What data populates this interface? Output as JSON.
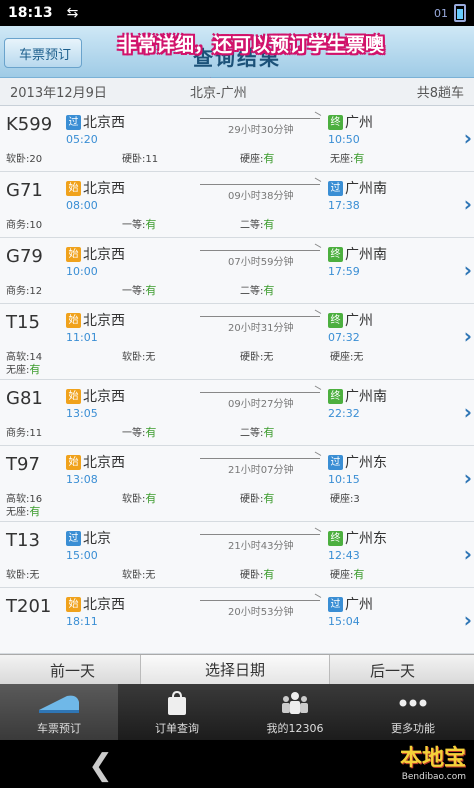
{
  "status": {
    "time": "18:13",
    "usb": "⇆",
    "battery_label": "01"
  },
  "header": {
    "back_label": "车票预订",
    "title": "查询结果"
  },
  "annotation": "非常详细，还可以预订学生票噢",
  "info": {
    "date": "2013年12月9日",
    "route": "北京-广州",
    "count": "共8趟车"
  },
  "trains": [
    {
      "code": "K599",
      "from_tag": "过",
      "from": "北京西",
      "dep": "05:20",
      "to_tag": "终",
      "to": "广州",
      "arr": "10:50",
      "duration": "29小时30分钟",
      "seats": [
        {
          "label": "软卧:",
          "value": "20",
          "avail": false
        },
        {
          "label": "硬卧:",
          "value": "11",
          "avail": false
        },
        {
          "label": "硬座:",
          "value": "有",
          "avail": true
        },
        {
          "label": "无座:",
          "value": "有",
          "avail": true
        }
      ],
      "extra": null
    },
    {
      "code": "G71",
      "from_tag": "始",
      "from": "北京西",
      "dep": "08:00",
      "to_tag": "过",
      "to": "广州南",
      "arr": "17:38",
      "duration": "09小时38分钟",
      "seats": [
        {
          "label": "商务:",
          "value": "10",
          "avail": false
        },
        {
          "label": "一等:",
          "value": "有",
          "avail": true
        },
        {
          "label": "二等:",
          "value": "有",
          "avail": true
        }
      ],
      "extra": null
    },
    {
      "code": "G79",
      "from_tag": "始",
      "from": "北京西",
      "dep": "10:00",
      "to_tag": "终",
      "to": "广州南",
      "arr": "17:59",
      "duration": "07小时59分钟",
      "seats": [
        {
          "label": "商务:",
          "value": "12",
          "avail": false
        },
        {
          "label": "一等:",
          "value": "有",
          "avail": true
        },
        {
          "label": "二等:",
          "value": "有",
          "avail": true
        }
      ],
      "extra": null
    },
    {
      "code": "T15",
      "from_tag": "始",
      "from": "北京西",
      "dep": "11:01",
      "to_tag": "终",
      "to": "广州",
      "arr": "07:32",
      "duration": "20小时31分钟",
      "seats": [
        {
          "label": "高软:",
          "value": "14",
          "avail": false
        },
        {
          "label": "软卧:",
          "value": "无",
          "avail": false
        },
        {
          "label": "硬卧:",
          "value": "无",
          "avail": false
        },
        {
          "label": "硬座:",
          "value": "无",
          "avail": false
        }
      ],
      "extra": {
        "label": "无座:",
        "value": "有",
        "avail": true
      }
    },
    {
      "code": "G81",
      "from_tag": "始",
      "from": "北京西",
      "dep": "13:05",
      "to_tag": "终",
      "to": "广州南",
      "arr": "22:32",
      "duration": "09小时27分钟",
      "seats": [
        {
          "label": "商务:",
          "value": "11",
          "avail": false
        },
        {
          "label": "一等:",
          "value": "有",
          "avail": true
        },
        {
          "label": "二等:",
          "value": "有",
          "avail": true
        }
      ],
      "extra": null
    },
    {
      "code": "T97",
      "from_tag": "始",
      "from": "北京西",
      "dep": "13:08",
      "to_tag": "过",
      "to": "广州东",
      "arr": "10:15",
      "duration": "21小时07分钟",
      "seats": [
        {
          "label": "高软:",
          "value": "16",
          "avail": false
        },
        {
          "label": "软卧:",
          "value": "有",
          "avail": true
        },
        {
          "label": "硬卧:",
          "value": "有",
          "avail": true
        },
        {
          "label": "硬座:",
          "value": "3",
          "avail": false
        }
      ],
      "extra": {
        "label": "无座:",
        "value": "有",
        "avail": true
      }
    },
    {
      "code": "T13",
      "from_tag": "过",
      "from": "北京",
      "dep": "15:00",
      "to_tag": "终",
      "to": "广州东",
      "arr": "12:43",
      "duration": "21小时43分钟",
      "seats": [
        {
          "label": "软卧:",
          "value": "无",
          "avail": false
        },
        {
          "label": "软卧:",
          "value": "无",
          "avail": false
        },
        {
          "label": "硬卧:",
          "value": "有",
          "avail": true
        },
        {
          "label": "硬座:",
          "value": "有",
          "avail": true
        }
      ],
      "extra": null
    },
    {
      "code": "T201",
      "from_tag": "始",
      "from": "北京西",
      "dep": "18:11",
      "to_tag": "过",
      "to": "广州",
      "arr": "15:04",
      "duration": "20小时53分钟",
      "seats": [],
      "extra": null
    }
  ],
  "date_nav": {
    "prev": "前一天",
    "pick": "选择日期",
    "next": "后一天"
  },
  "tabs": [
    {
      "label": "车票预订",
      "icon": "train-icon",
      "active": true
    },
    {
      "label": "订单查询",
      "icon": "bag-icon",
      "active": false
    },
    {
      "label": "我的12306",
      "icon": "people-icon",
      "active": false
    },
    {
      "label": "更多功能",
      "icon": "more-icon",
      "active": false
    }
  ],
  "watermark": {
    "big": "本地宝",
    "small": "Bendibao.com"
  },
  "colors": {
    "accent": "#3a8ed4",
    "available": "#3c9b2c",
    "header": "#9fcbe6"
  }
}
